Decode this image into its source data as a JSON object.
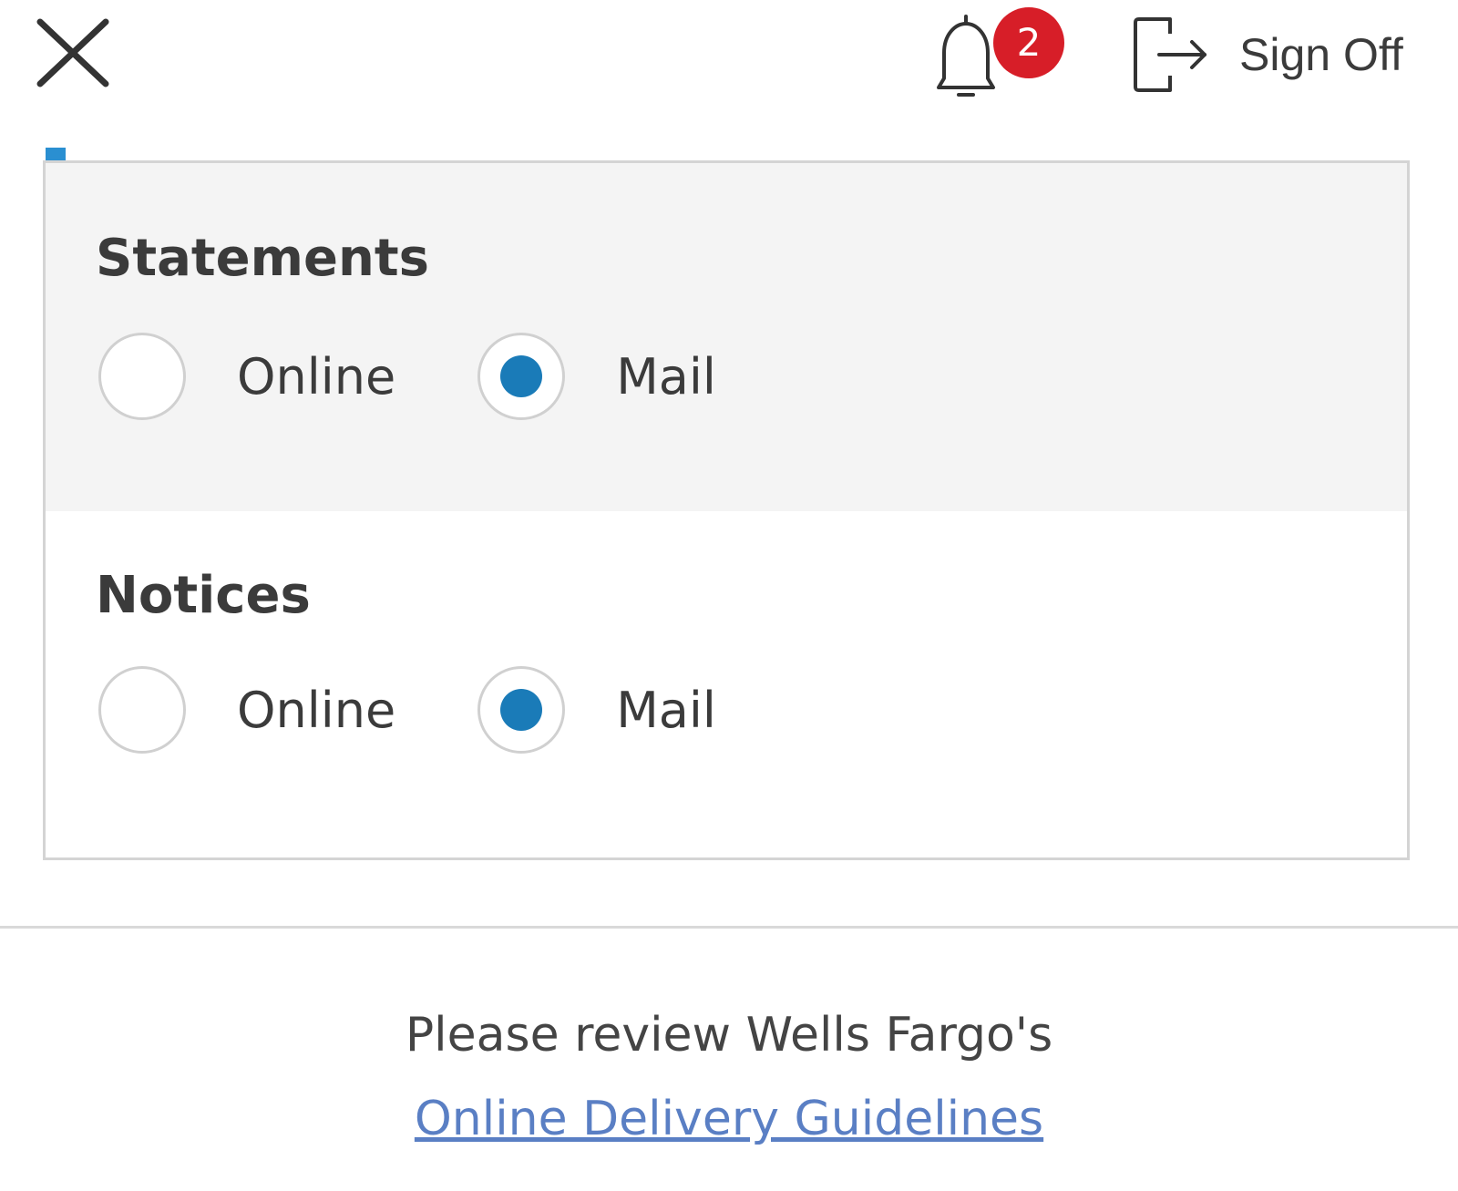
{
  "header": {
    "notifications_count": "2",
    "sign_off_label": "Sign Off"
  },
  "delivery_preferences": {
    "statements": {
      "title": "Statements",
      "options": [
        {
          "label": "Online",
          "selected": false
        },
        {
          "label": "Mail",
          "selected": true
        }
      ]
    },
    "notices": {
      "title": "Notices",
      "options": [
        {
          "label": "Online",
          "selected": false
        },
        {
          "label": "Mail",
          "selected": true
        }
      ]
    }
  },
  "footer": {
    "text": "Please review Wells Fargo's",
    "link_label": "Online Delivery Guidelines"
  },
  "colors": {
    "badge": "#d71e28",
    "radio_selected": "#1a7bb8",
    "link": "#5a7fc4",
    "section_shade": "#f4f4f4"
  }
}
